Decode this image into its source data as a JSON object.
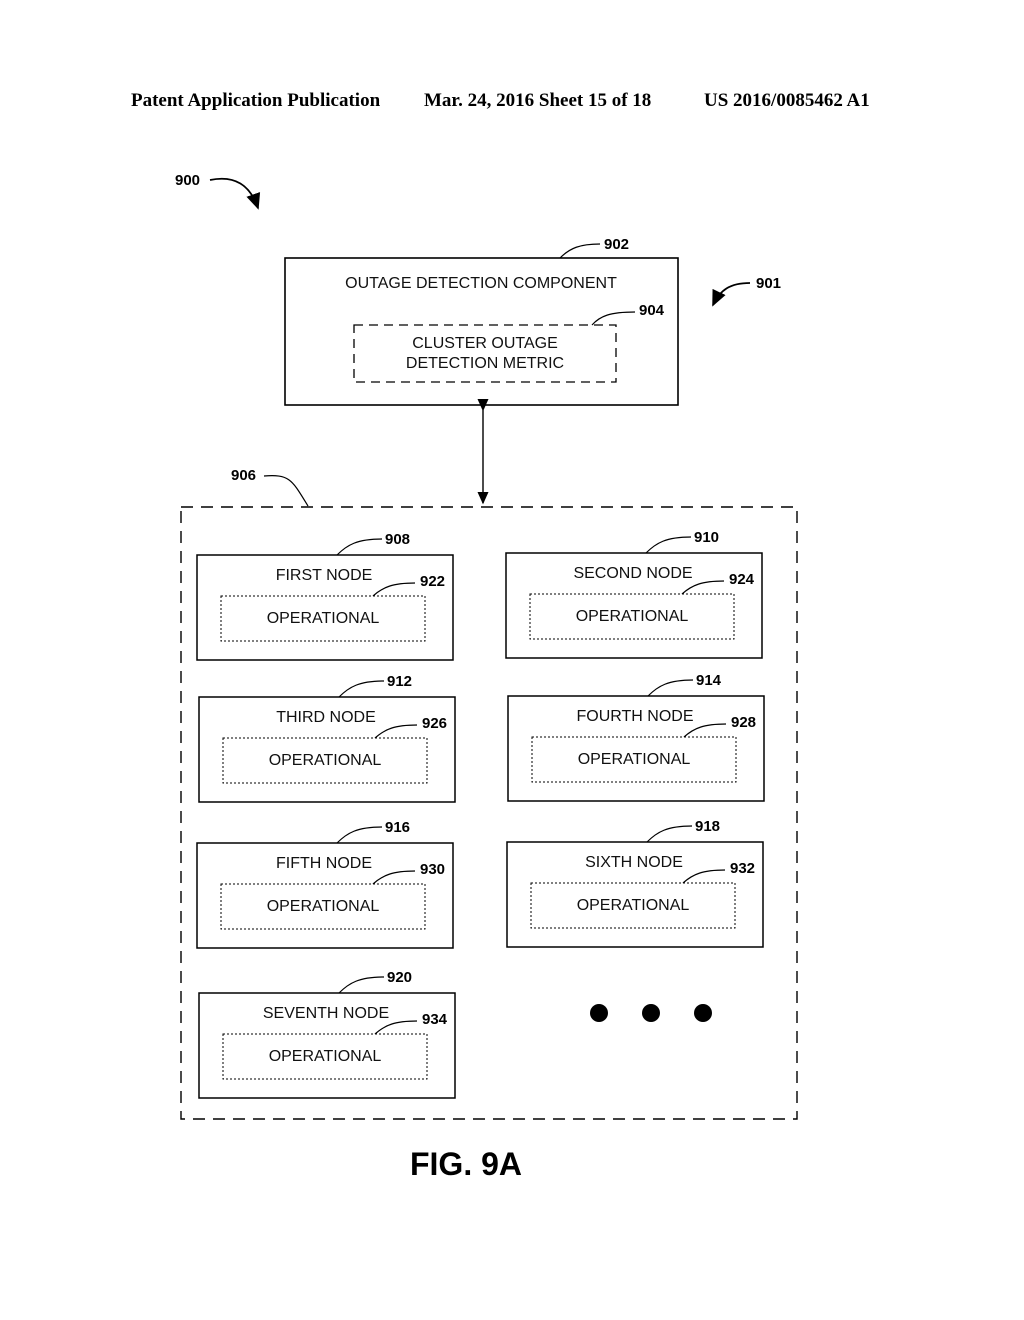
{
  "header": {
    "publication": "Patent Application Publication",
    "date_sheet": "Mar. 24, 2016  Sheet 15 of 18",
    "patent_number": "US 2016/0085462 A1"
  },
  "figure": {
    "label": "FIG. 9A",
    "ref_system": "900",
    "ref_top_group": "901",
    "component": {
      "ref": "902",
      "title": "OUTAGE DETECTION COMPONENT"
    },
    "metric": {
      "ref": "904",
      "line1": "CLUSTER OUTAGE",
      "line2": "DETECTION METRIC"
    },
    "cluster": {
      "ref": "906"
    },
    "nodes": [
      {
        "ref": "908",
        "name": "FIRST NODE",
        "status_ref": "922",
        "status": "OPERATIONAL"
      },
      {
        "ref": "910",
        "name": "SECOND NODE",
        "status_ref": "924",
        "status": "OPERATIONAL"
      },
      {
        "ref": "912",
        "name": "THIRD NODE",
        "status_ref": "926",
        "status": "OPERATIONAL"
      },
      {
        "ref": "914",
        "name": "FOURTH NODE",
        "status_ref": "928",
        "status": "OPERATIONAL"
      },
      {
        "ref": "916",
        "name": "FIFTH NODE",
        "status_ref": "930",
        "status": "OPERATIONAL"
      },
      {
        "ref": "918",
        "name": "SIXTH NODE",
        "status_ref": "932",
        "status": "OPERATIONAL"
      },
      {
        "ref": "920",
        "name": "SEVENTH NODE",
        "status_ref": "934",
        "status": "OPERATIONAL"
      }
    ]
  }
}
